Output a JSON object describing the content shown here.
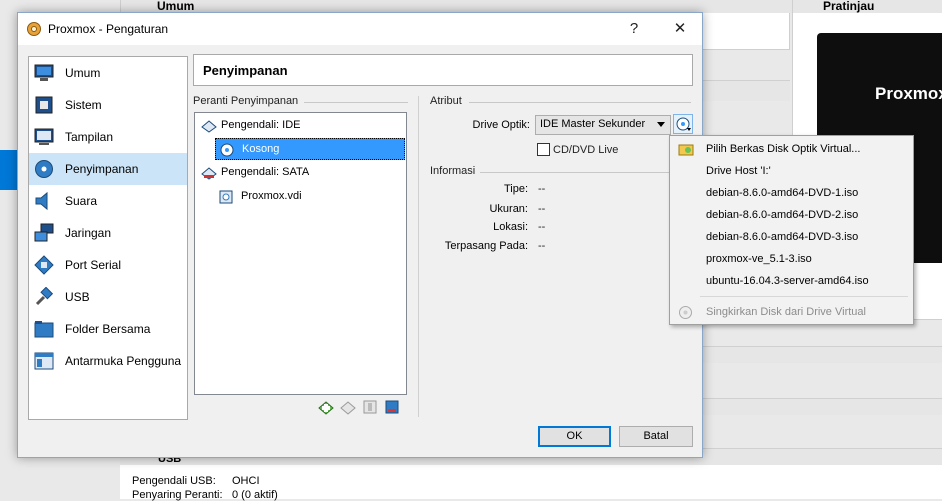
{
  "background": {
    "section_general": "Umum",
    "section_preview": "Pratinjau",
    "preview_text": "Proxmox",
    "section_usb": "USB",
    "usb_controller_label": "Pengendali USB:",
    "usb_controller_value": "OHCI",
    "device_filters_label": "Penyaring Peranti:",
    "device_filters_value": "0 (0 aktif)"
  },
  "dialog": {
    "title": "Proxmox - Pengaturan",
    "help_label": "?",
    "close_label": "✕",
    "sidebar": [
      {
        "label": "Umum",
        "icon": "monitor-icon"
      },
      {
        "label": "Sistem",
        "icon": "chip-icon"
      },
      {
        "label": "Tampilan",
        "icon": "display-icon"
      },
      {
        "label": "Penyimpanan",
        "icon": "disk-icon"
      },
      {
        "label": "Suara",
        "icon": "speaker-icon"
      },
      {
        "label": "Jaringan",
        "icon": "network-icon"
      },
      {
        "label": "Port Serial",
        "icon": "serial-port-icon"
      },
      {
        "label": "USB",
        "icon": "usb-icon"
      },
      {
        "label": "Folder Bersama",
        "icon": "folder-icon"
      },
      {
        "label": "Antarmuka Pengguna",
        "icon": "window-icon"
      }
    ],
    "page_title": "Penyimpanan",
    "storage_devices_label": "Peranti Penyimpanan",
    "tree": [
      {
        "label": "Pengendali: IDE",
        "level": 0,
        "icon": "ide-controller-icon"
      },
      {
        "label": "Kosong",
        "level": 1,
        "icon": "optical-disc-icon",
        "selected": true
      },
      {
        "label": "Pengendali: SATA",
        "level": 0,
        "icon": "sata-controller-icon"
      },
      {
        "label": "Proxmox.vdi",
        "level": 1,
        "icon": "hard-disk-icon"
      }
    ],
    "attributes_label": "Atribut",
    "optical_drive_label": "Drive Optik:",
    "optical_drive_value": "IDE Master Sekunder",
    "live_cd_label": "CD/DVD Live",
    "information_label": "Informasi",
    "info": [
      {
        "label": "Tipe:",
        "value": "--"
      },
      {
        "label": "Ukuran:",
        "value": "--"
      },
      {
        "label": "Lokasi:",
        "value": "--"
      },
      {
        "label": "Terpasang Pada:",
        "value": "--"
      }
    ],
    "ok_label": "OK",
    "cancel_label": "Batal"
  },
  "menu": {
    "items": [
      {
        "label": "Pilih Berkas Disk Optik Virtual...",
        "enabled": true
      },
      {
        "label": "Drive Host 'I:'",
        "enabled": true
      },
      {
        "label": "debian-8.6.0-amd64-DVD-1.iso",
        "enabled": true
      },
      {
        "label": "debian-8.6.0-amd64-DVD-2.iso",
        "enabled": true
      },
      {
        "label": "debian-8.6.0-amd64-DVD-3.iso",
        "enabled": true
      },
      {
        "label": "proxmox-ve_5.1-3.iso",
        "enabled": true
      },
      {
        "label": "ubuntu-16.04.3-server-amd64.iso",
        "enabled": true
      }
    ],
    "remove_label": "Singkirkan Disk dari Drive Virtual"
  }
}
